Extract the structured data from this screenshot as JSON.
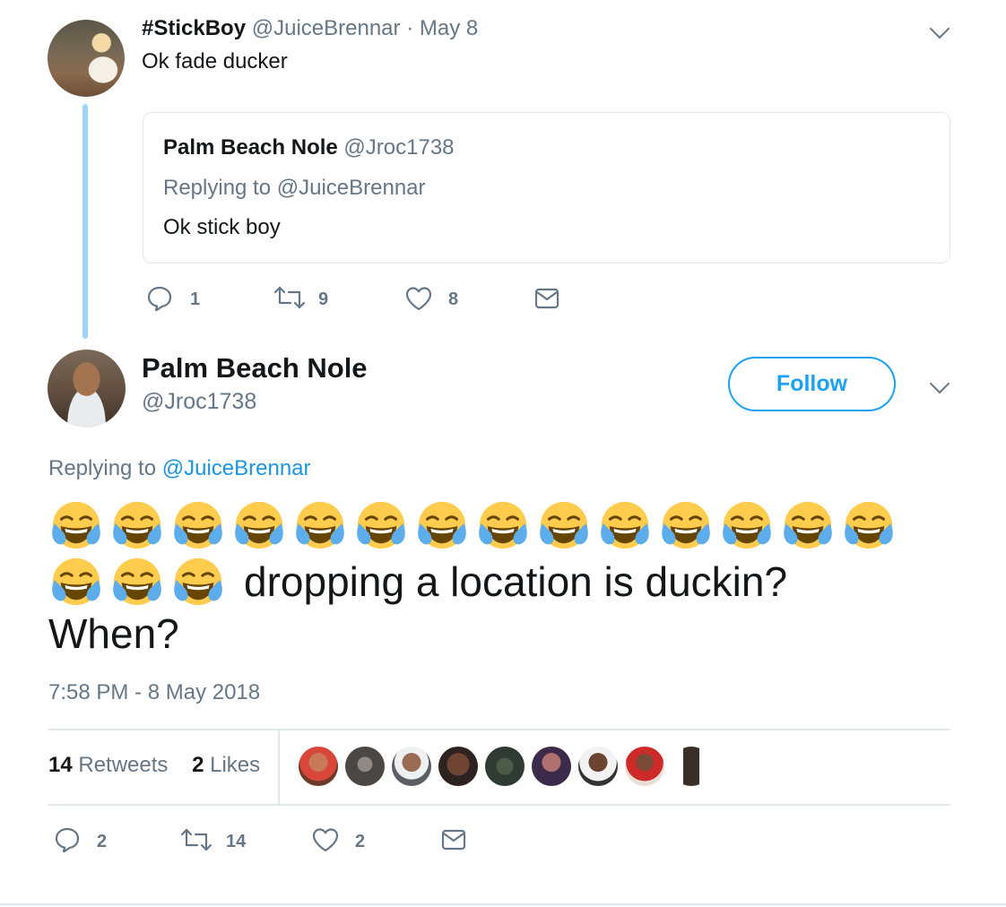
{
  "original_tweet": {
    "display_name": "#StickBoy",
    "handle": "@JuiceBrennar",
    "date": "· May 8",
    "text": "Ok fade ducker",
    "quoted": {
      "display_name": "Palm Beach Nole",
      "handle": "@Jroc1738",
      "replying_to": "Replying to @JuiceBrennar",
      "text": "Ok stick boy"
    },
    "actions": {
      "replies": "1",
      "retweets": "9",
      "likes": "8"
    }
  },
  "main_tweet": {
    "display_name": "Palm Beach Nole",
    "handle": "@Jroc1738",
    "follow_label": "Follow",
    "replying_prefix": "Replying to",
    "replying_handle": "@JuiceBrennar",
    "emoji": "face-with-tears-of-joy",
    "emoji_row1_count": 14,
    "emoji_row2_count": 3,
    "text_line2": "dropping a location is duckin?",
    "text_line3": "When?",
    "timestamp": "7:58 PM - 8 May 2018",
    "stats": {
      "retweets_count": "14",
      "retweets_label": "Retweets",
      "likes_count": "2",
      "likes_label": "Likes"
    },
    "liker_avatar_count": 9,
    "actions": {
      "replies": "2",
      "retweets": "14",
      "likes": "2"
    }
  },
  "colors": {
    "accent": "#1da1f2",
    "link": "#1b95e0",
    "muted": "#657786",
    "text": "#14171a",
    "border": "#e1e8ed",
    "thread_line": "#9fd4f5"
  }
}
